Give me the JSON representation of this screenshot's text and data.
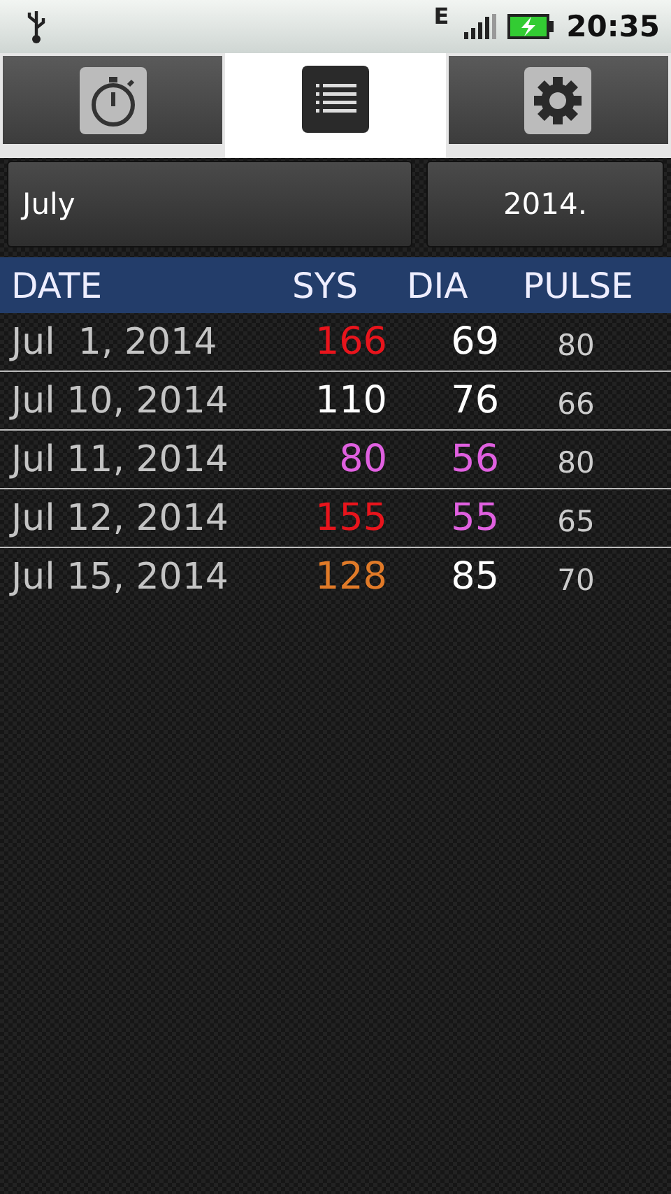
{
  "status_bar": {
    "network": "E",
    "time": "20:35"
  },
  "tabs": [
    {
      "kind": "timer",
      "selected": false
    },
    {
      "kind": "list",
      "selected": true
    },
    {
      "kind": "settings",
      "selected": false
    }
  ],
  "month": "July",
  "year": "2014.",
  "table": {
    "columns": [
      "DATE",
      "SYS",
      "DIA",
      "PULSE"
    ],
    "rows": [
      {
        "date": "Jul  1, 2014",
        "sys": {
          "text": "166",
          "color": "#e8141c"
        },
        "dia": {
          "text": "69",
          "color": "#ffffff"
        },
        "pulse": "80"
      },
      {
        "date": "Jul 10, 2014",
        "sys": {
          "text": "110",
          "color": "#ffffff"
        },
        "dia": {
          "text": "76",
          "color": "#ffffff"
        },
        "pulse": "66"
      },
      {
        "date": "Jul 11, 2014",
        "sys": {
          "text": "80",
          "color": "#e060e0"
        },
        "dia": {
          "text": "56",
          "color": "#e060e0"
        },
        "pulse": "80"
      },
      {
        "date": "Jul 12, 2014",
        "sys": {
          "text": "155",
          "color": "#e8141c"
        },
        "dia": {
          "text": "55",
          "color": "#e060e0"
        },
        "pulse": "65"
      },
      {
        "date": "Jul 15, 2014",
        "sys": {
          "text": "128",
          "color": "#e07a28"
        },
        "dia": {
          "text": "85",
          "color": "#ffffff"
        },
        "pulse": "70"
      }
    ]
  }
}
